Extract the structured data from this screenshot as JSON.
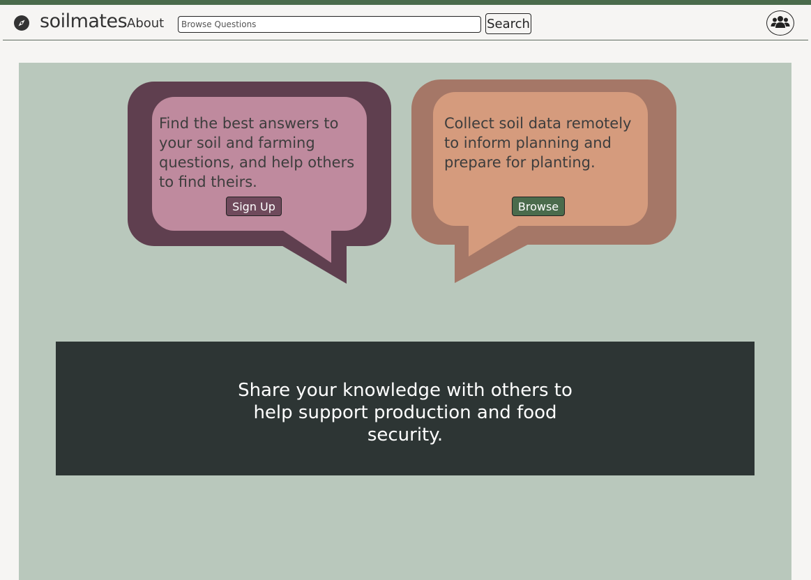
{
  "header": {
    "brand": "soilmates",
    "about_label": "About",
    "search_placeholder": "Browse Questions",
    "search_label": "Search",
    "logo_icon": "compass-icon",
    "profile_icon": "users-icon"
  },
  "bubbles": [
    {
      "text": "Find the best answers to your soil and farming questions, and help others to find theirs.",
      "button_label": "Sign Up"
    },
    {
      "text": "Collect soil data remotely to inform planning and prepare for planting.",
      "button_label": "Browse"
    }
  ],
  "banner": {
    "text": "Share your knowledge with others to help support production and food security."
  },
  "colors": {
    "accent_green": "#4a6b4c",
    "bubble1_outer": "#5f3f4f",
    "bubble1_inner": "#bf8a9e",
    "bubble2_outer": "#a57767",
    "bubble2_inner": "#d59b7d",
    "panel": "#b9c8bc",
    "banner": "#2d3534"
  }
}
